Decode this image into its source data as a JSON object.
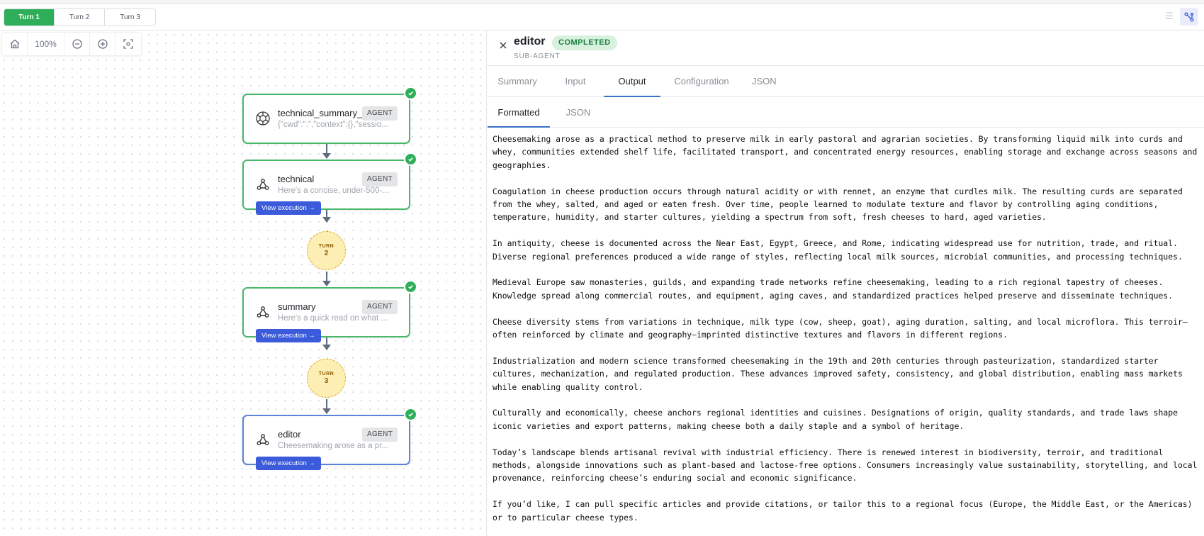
{
  "turns": [
    "Turn 1",
    "Turn 2",
    "Turn 3"
  ],
  "zoom": {
    "level": "100%"
  },
  "nodes": [
    {
      "title": "technical_summary_e",
      "subtitle": "{\"cwd\":\".\",\"context\":{},\"sessio...",
      "badge": "AGENT",
      "icon": "openai-logo-icon"
    },
    {
      "title": "technical",
      "subtitle": "Here's a concise, under-500-...",
      "badge": "AGENT",
      "icon": "agent-hierarchy-icon",
      "action": "View execution →"
    },
    {
      "title": "summary",
      "subtitle": "Here's a quick read on what ...",
      "badge": "AGENT",
      "icon": "agent-hierarchy-icon",
      "action": "View execution →"
    },
    {
      "title": "editor",
      "subtitle": "Cheesemaking arose as a pr...",
      "badge": "AGENT",
      "icon": "agent-hierarchy-icon",
      "action": "View execution →"
    }
  ],
  "turn_markers": [
    {
      "label": "TURN",
      "number": "2"
    },
    {
      "label": "TURN",
      "number": "3"
    }
  ],
  "panel": {
    "title": "editor",
    "status": "COMPLETED",
    "subtitle": "SUB-AGENT",
    "tabs": [
      "Summary",
      "Input",
      "Output",
      "Configuration",
      "JSON"
    ],
    "subtabs": [
      "Formatted",
      "JSON"
    ],
    "paragraphs": [
      "Cheesemaking arose as a practical method to preserve milk in early pastoral and agrarian societies. By transforming liquid milk into curds and whey, communities extended shelf life, facilitated transport, and concentrated energy resources, enabling storage and exchange across seasons and geographies.",
      "Coagulation in cheese production occurs through natural acidity or with rennet, an enzyme that curdles milk. The resulting curds are separated from the whey, salted, and aged or eaten fresh. Over time, people learned to modulate texture and flavor by controlling aging conditions, temperature, humidity, and starter cultures, yielding a spectrum from soft, fresh cheeses to hard, aged varieties.",
      "In antiquity, cheese is documented across the Near East, Egypt, Greece, and Rome, indicating widespread use for nutrition, trade, and ritual. Diverse regional preferences produced a wide range of styles, reflecting local milk sources, microbial communities, and processing techniques.",
      "Medieval Europe saw monasteries, guilds, and expanding trade networks refine cheesemaking, leading to a rich regional tapestry of cheeses. Knowledge spread along commercial routes, and equipment, aging caves, and standardized practices helped preserve and disseminate techniques.",
      "Cheese diversity stems from variations in technique, milk type (cow, sheep, goat), aging duration, salting, and local microflora. This terroir—often reinforced by climate and geography—imprinted distinctive textures and flavors in different regions.",
      "Industrialization and modern science transformed cheesemaking in the 19th and 20th centuries through pasteurization, standardized starter cultures, mechanization, and regulated production. These advances improved safety, consistency, and global distribution, enabling mass markets while enabling quality control.",
      "Culturally and economically, cheese anchors regional identities and cuisines. Designations of origin, quality standards, and trade laws shape iconic varieties and export patterns, making cheese both a daily staple and a symbol of heritage.",
      "Today’s landscape blends artisanal revival with industrial efficiency. There is renewed interest in biodiversity, terroir, and traditional methods, alongside innovations such as plant-based and lactose-free options. Consumers increasingly value sustainability, storytelling, and local provenance, reinforcing cheese’s enduring social and economic significance.",
      "If you’d like, I can pull specific articles and provide citations, or tailor this to a regional focus (Europe, the Middle East, or the Americas) or to particular cheese types."
    ]
  }
}
